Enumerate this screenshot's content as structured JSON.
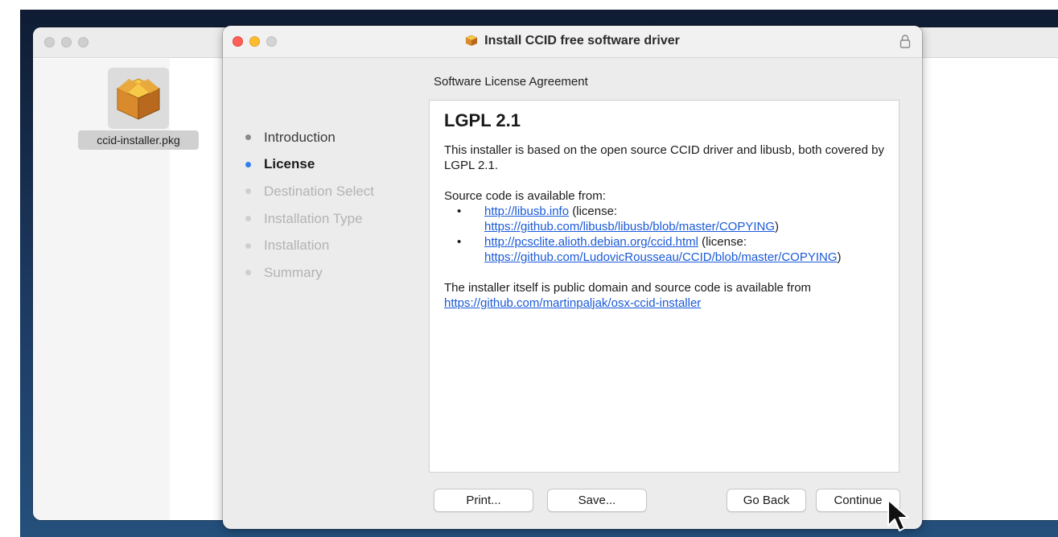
{
  "installer": {
    "title": "Install CCID free software driver",
    "subtitle": "Software License Agreement",
    "steps": [
      {
        "label": "Introduction",
        "state": "done"
      },
      {
        "label": "License",
        "state": "current"
      },
      {
        "label": "Destination Select",
        "state": "future"
      },
      {
        "label": "Installation Type",
        "state": "future"
      },
      {
        "label": "Installation",
        "state": "future"
      },
      {
        "label": "Summary",
        "state": "future"
      }
    ],
    "license": {
      "heading": "LGPL 2.1",
      "intro": "This installer is based on the open source CCID driver and libusb, both covered by LGPL 2.1.",
      "source_intro": "Source code is available from:",
      "items": [
        {
          "link": "http://libusb.info",
          "license_prefix": " (license: ",
          "license_link": "https://github.com/libusb/libusb/blob/master/COPYING",
          "suffix": ")"
        },
        {
          "link": "http://pcsclite.alioth.debian.org/ccid.html",
          "license_prefix": " (license: ",
          "license_link": "https://github.com/LudovicRousseau/CCID/blob/master/COPYING",
          "suffix": ")"
        }
      ],
      "outro_text": "The installer itself is public domain and source code is available from ",
      "outro_link": "https://github.com/martinpaljak/osx-ccid-installer"
    },
    "buttons": {
      "print": "Print...",
      "save": "Save...",
      "go_back": "Go Back",
      "continue": "Continue"
    }
  },
  "finder": {
    "file_name": "ccid-installer.pkg"
  },
  "icons": {
    "package": "package-icon",
    "lock": "lock-icon",
    "cursor": "mouse-cursor-icon"
  },
  "colors": {
    "accent": "#2f7ff0",
    "link": "#1a5ad8",
    "close": "#ff5f57",
    "minimize": "#febc2e"
  }
}
